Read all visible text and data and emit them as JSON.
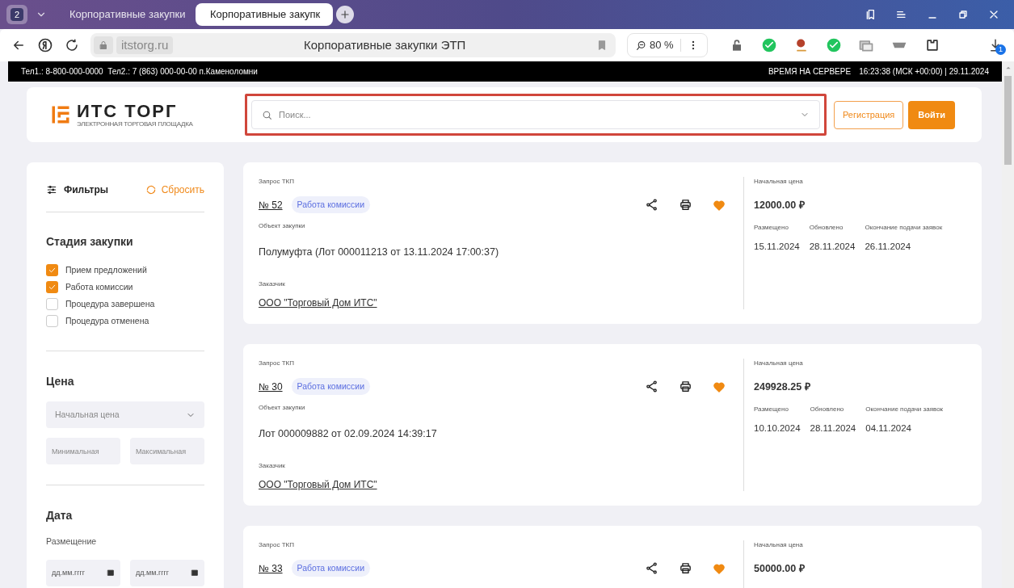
{
  "browser": {
    "tab_count": "2",
    "tabs": [
      {
        "title": "Корпоративные закупки",
        "selected": false
      },
      {
        "title": "Корпоративные закупк",
        "selected": true
      }
    ],
    "address": "itstorg.ru",
    "page_title": "Корпоративные закупки ЭТП",
    "zoom": "80 %",
    "downloads_badge": "1"
  },
  "info_bar": {
    "phones": "Тел1.: 8-800-000-0000  Тел2.: 7 (863) 000-00-00 п.Каменоломни",
    "server_time_label": "ВРЕМЯ НА СЕРВЕРЕ",
    "server_time": "16:23:38 (МСК +00:00) | 29.11.2024"
  },
  "header": {
    "logo_title": "ИТС ТОРГ",
    "logo_subtitle": "ЭЛЕКТРОННАЯ ТОРГОВАЯ ПЛОЩАДКА",
    "search": {
      "placeholder": "Поиск..."
    },
    "register": "Регистрация",
    "login": "Войти"
  },
  "filters": {
    "title": "Фильтры",
    "reset": "Сбросить",
    "stage_heading": "Стадия закупки",
    "stages": [
      {
        "label": "Прием предложений",
        "checked": true
      },
      {
        "label": "Работа комиссии",
        "checked": true
      },
      {
        "label": "Процедура завершена",
        "checked": false
      },
      {
        "label": "Процедура отменена",
        "checked": false
      }
    ],
    "price_heading": "Цена",
    "price_select": {
      "placeholder": "Начальная цена"
    },
    "price_min": {
      "placeholder": "Минимальная"
    },
    "price_max": {
      "placeholder": "Максимальная"
    },
    "date_heading": "Дата",
    "placement_label": "Размещение",
    "date_from": {
      "placeholder": "дд.мм.гггг"
    },
    "date_to": {
      "placeholder": "дд.мм.гггг"
    }
  },
  "cards": [
    {
      "type": "Запрос ТКП",
      "number": "№ 52",
      "status": "Работа комиссии",
      "favorite": true,
      "object_label": "Объект закупки",
      "object": "Полумуфта (Лот 000011213 от 13.11.2024 17:00:37)",
      "customer_label": "Заказчик",
      "customer": "ООО \"Торговый Дом ИТС\"",
      "price_label": "Начальная цена",
      "price": "12000.00 ₽",
      "dates": [
        {
          "label": "Размещено",
          "value": "15.11.2024"
        },
        {
          "label": "Обновлено",
          "value": "28.11.2024"
        },
        {
          "label": "Окончание подачи заявок",
          "value": "26.11.2024"
        }
      ]
    },
    {
      "type": "Запрос ТКП",
      "number": "№ 30",
      "status": "Работа комиссии",
      "favorite": true,
      "object_label": "Объект закупки",
      "object": "Лот 000009882 от 02.09.2024 14:39:17",
      "customer_label": "Заказчик",
      "customer": "ООО \"Торговый Дом ИТС\"",
      "price_label": "Начальная цена",
      "price": "249928.25 ₽",
      "dates": [
        {
          "label": "Размещено",
          "value": "10.10.2024"
        },
        {
          "label": "Обновлено",
          "value": "28.11.2024"
        },
        {
          "label": "Окончание подачи заявок",
          "value": "04.11.2024"
        }
      ]
    },
    {
      "type": "Запрос ТКП",
      "number": "№ 33",
      "status": "Работа комиссии",
      "favorite": true,
      "price_label": "Начальная цена",
      "price": "50000.00 ₽"
    }
  ]
}
